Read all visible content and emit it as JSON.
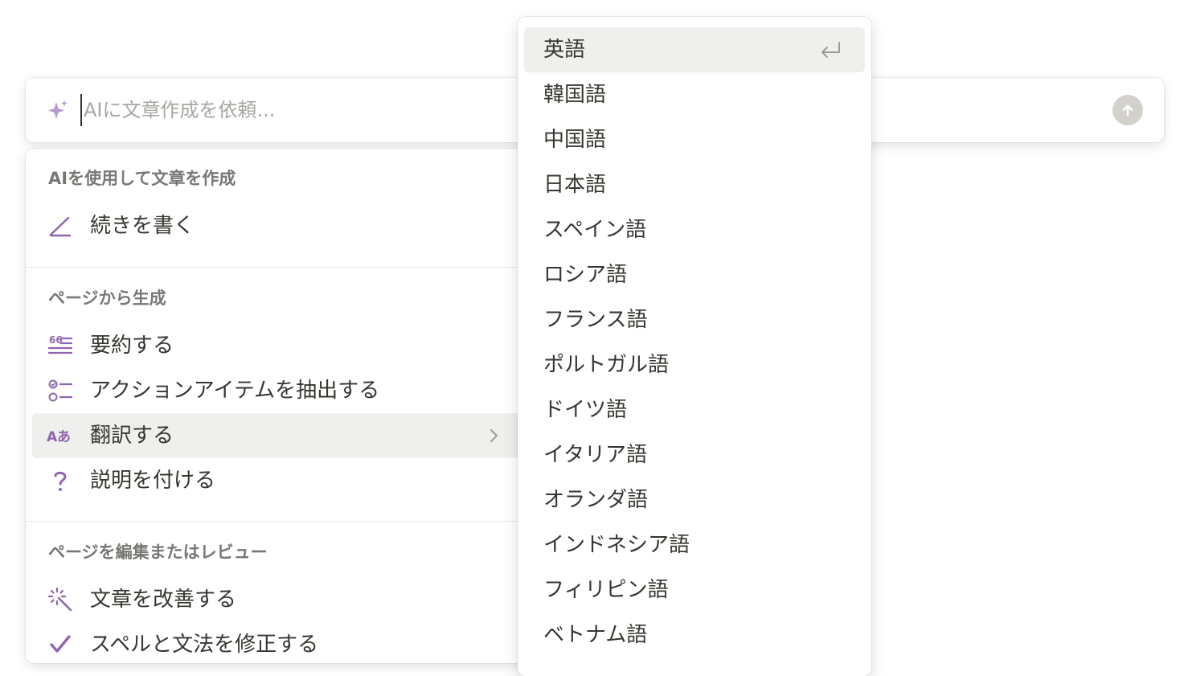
{
  "prompt": {
    "placeholder": "AIに文章作成を依頼..."
  },
  "left_menu": {
    "sections": [
      {
        "title": "AIを使用して文章を作成",
        "items": [
          {
            "label": "続きを書く",
            "icon": "pencil-icon"
          }
        ]
      },
      {
        "title": "ページから生成",
        "items": [
          {
            "label": "要約する",
            "icon": "summary-lines-icon"
          },
          {
            "label": "アクションアイテムを抽出する",
            "icon": "checklist-icon"
          },
          {
            "label": "翻訳する",
            "icon": "translate-icon",
            "active": true,
            "submenu": true
          },
          {
            "label": "説明を付ける",
            "icon": "question-mark-icon"
          }
        ]
      },
      {
        "title": "ページを編集またはレビュー",
        "items": [
          {
            "label": "文章を改善する",
            "icon": "magic-wand-icon"
          },
          {
            "label": "スペルと文法を修正する",
            "icon": "checkmark-icon"
          }
        ]
      }
    ]
  },
  "language_menu": {
    "items": [
      "英語",
      "韓国語",
      "中国語",
      "日本語",
      "スペイン語",
      "ロシア語",
      "フランス語",
      "ポルトガル語",
      "ドイツ語",
      "イタリア語",
      "オランダ語",
      "インドネシア語",
      "フィリピン語",
      "ベトナム語"
    ],
    "active_index": 0
  },
  "colors": {
    "accent_purple": "#9065b0",
    "hover_bg": "#efefed",
    "send_button": "#d3d1cb"
  }
}
